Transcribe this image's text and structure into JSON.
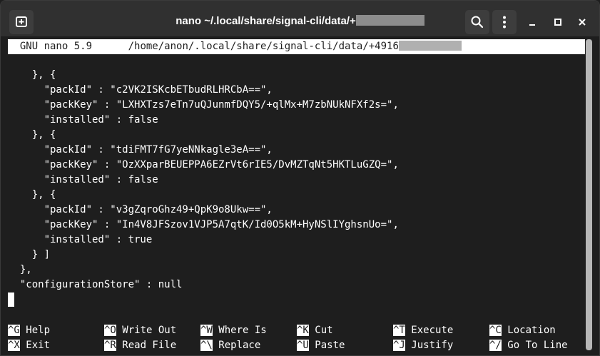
{
  "window": {
    "title_prefix": "nano ~/.local/share/signal-cli/data/+",
    "buttons": {
      "new_tab": "new-tab",
      "search": "search",
      "menu": "menu"
    },
    "controls": {
      "minimize": "–",
      "maximize": "□",
      "close": "✕"
    }
  },
  "nano": {
    "version_label": "GNU nano 5.9",
    "file_path": "/home/anon/.local/share/signal-cli/data/+4916"
  },
  "content": {
    "lines": [
      "    }, {",
      "      \"packId\" : \"c2VK2ISKcbETbudRLHRCbA==\",",
      "      \"packKey\" : \"LXHXTzs7eTn7uQJunmfDQY5/+qlMx+M7zbNUkNFXf2s=\",",
      "      \"installed\" : false",
      "    }, {",
      "      \"packId\" : \"tdiFMT7fG7yeNNkagle3eA==\",",
      "      \"packKey\" : \"OzXXparBEUEPPA6EZrVt6rIE5/DvMZTqNt5HKTLuGZQ=\",",
      "      \"installed\" : false",
      "    }, {",
      "      \"packId\" : \"v3gZqroGhz49+QpK9o8Ukw==\",",
      "      \"packKey\" : \"In4V8JFSzov1VJP5A7qtK/Id0O5kM+HyNSlIYghsnUo=\",",
      "      \"installed\" : true",
      "    } ]",
      "  },",
      "  \"configurationStore\" : null",
      "}"
    ]
  },
  "shortcuts": [
    {
      "key": "^G",
      "label": "Help"
    },
    {
      "key": "^O",
      "label": "Write Out"
    },
    {
      "key": "^W",
      "label": "Where Is"
    },
    {
      "key": "^K",
      "label": "Cut"
    },
    {
      "key": "^T",
      "label": "Execute"
    },
    {
      "key": "^C",
      "label": "Location"
    },
    {
      "key": "^X",
      "label": "Exit"
    },
    {
      "key": "^R",
      "label": "Read File"
    },
    {
      "key": "^\\",
      "label": "Replace"
    },
    {
      "key": "^U",
      "label": "Paste"
    },
    {
      "key": "^J",
      "label": "Justify"
    },
    {
      "key": "^/",
      "label": "Go To Line"
    }
  ]
}
